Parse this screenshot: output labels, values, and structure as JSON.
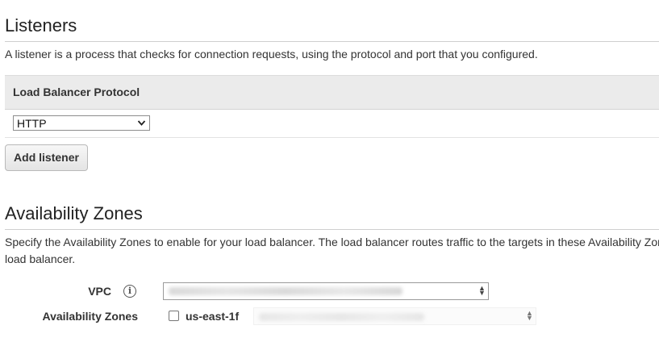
{
  "listeners": {
    "title": "Listeners",
    "description": "A listener is a process that checks for connection requests, using the protocol and port that you configured.",
    "table": {
      "column_header": "Load Balancer Protocol",
      "rows": [
        {
          "protocol": "HTTP"
        }
      ]
    },
    "add_button_label": "Add listener"
  },
  "availability_zones": {
    "title": "Availability Zones",
    "description_line1": "Specify the Availability Zones to enable for your load balancer. The load balancer routes traffic to the targets in these Availability Zon",
    "description_line2": "load balancer.",
    "vpc": {
      "label": "VPC",
      "info_icon_glyph": "i",
      "selected_value": ""
    },
    "zones": {
      "label": "Availability Zones",
      "items": [
        {
          "name": "us-east-1f",
          "checked": false,
          "subnet_value": ""
        }
      ]
    }
  }
}
